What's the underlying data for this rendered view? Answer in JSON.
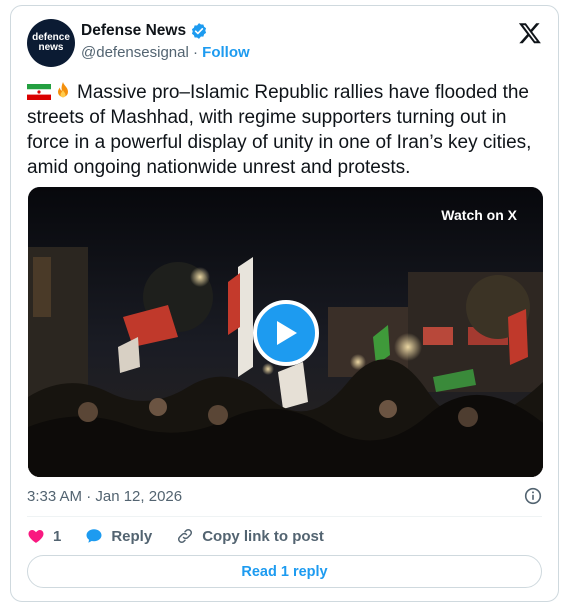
{
  "author": {
    "name": "Defense News",
    "handle": "@defensesignal",
    "separator": "·",
    "follow_label": "Follow",
    "avatar_text_line1": "defence",
    "avatar_text_line2": "news"
  },
  "post": {
    "text": "Massive pro–Islamic Republic rallies have flooded the streets of Mashhad, with regime supporters turning out in force in a powerful display of unity in one of Iran’s key cities, amid ongoing nationwide unrest and protests.",
    "emoji_icons": [
      "iran-flag-icon",
      "fire-icon"
    ],
    "timestamp": "3:33 AM · Jan 12, 2026"
  },
  "media": {
    "overlay_label": "Watch on X"
  },
  "actions": {
    "like_count": "1",
    "reply_label": "Reply",
    "copy_label": "Copy link to post"
  },
  "read_reply_label": "Read 1 reply",
  "colors": {
    "accent": "#1d9bf0",
    "like": "#f91880",
    "muted": "#536471",
    "border": "#cfd9de"
  }
}
